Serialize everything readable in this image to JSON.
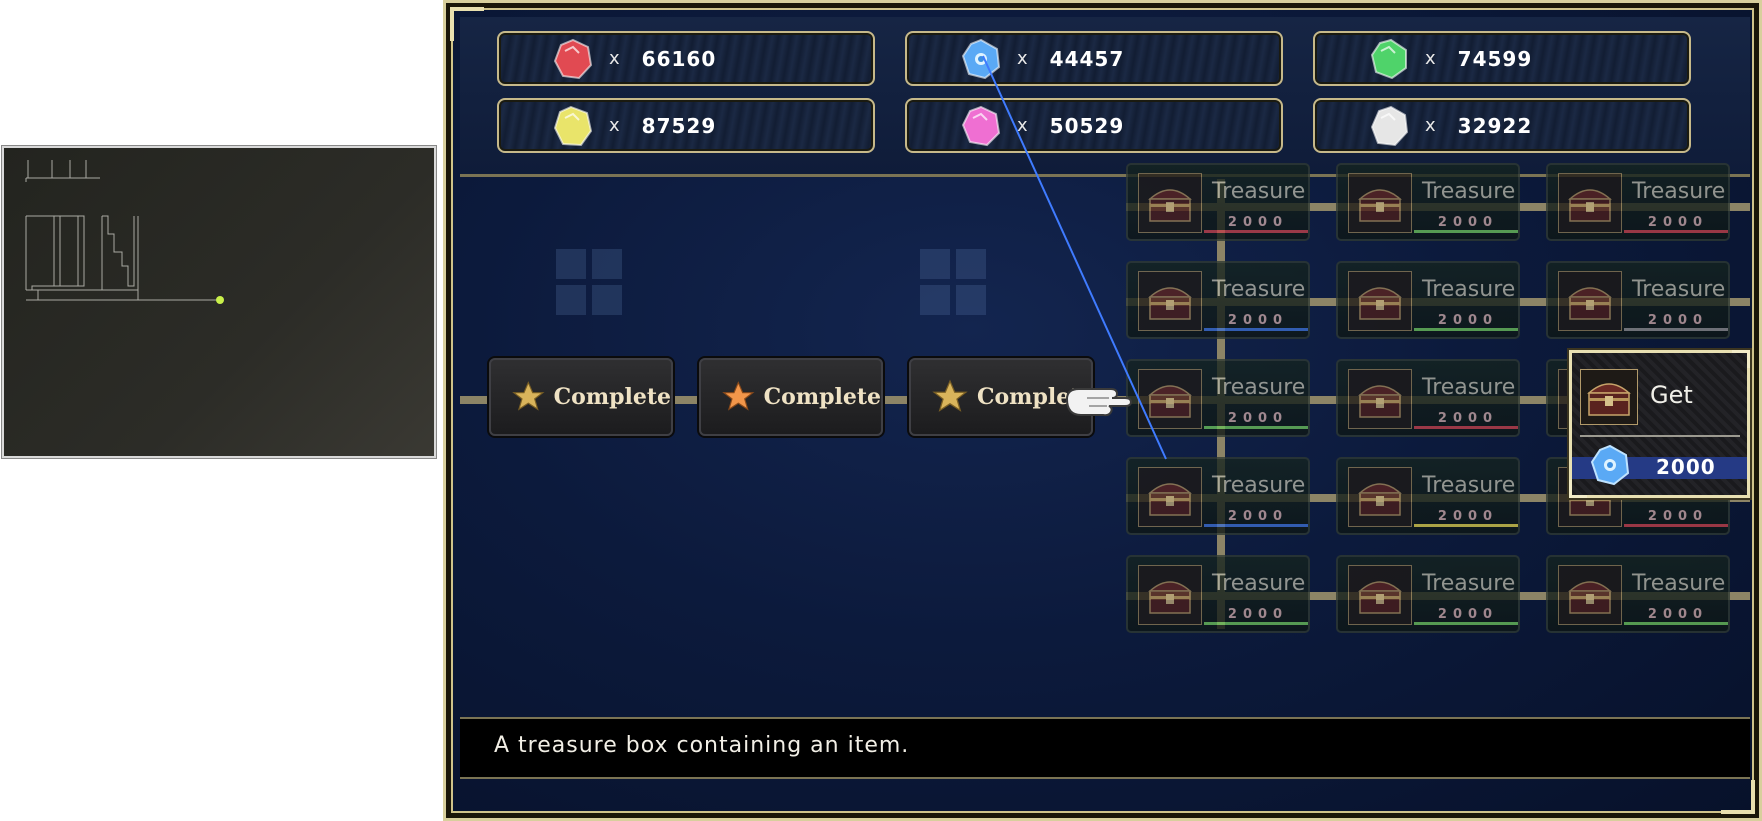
{
  "currencies": [
    {
      "color": "red",
      "hex": "#e14a52",
      "count": "66160",
      "multiplier": "x"
    },
    {
      "color": "blue",
      "hex": "#5aa9f5",
      "count": "44457",
      "multiplier": "x"
    },
    {
      "color": "green",
      "hex": "#4fd36a",
      "count": "74599",
      "multiplier": "x"
    },
    {
      "color": "yellow",
      "hex": "#e9e46a",
      "count": "87529",
      "multiplier": "x"
    },
    {
      "color": "pink",
      "hex": "#ef6fd2",
      "count": "50529",
      "multiplier": "x"
    },
    {
      "color": "white",
      "hex": "#e6e6e6",
      "count": "32922",
      "multiplier": "x"
    }
  ],
  "tree": {
    "completed": [
      {
        "label": "Complete",
        "star": "#d9b45b"
      },
      {
        "label": "Complete",
        "star": "#f2964a"
      },
      {
        "label": "Complet",
        "star": "#d9b45b"
      }
    ],
    "treasure_label": "Treasure",
    "treasure_cost": "2000",
    "selected": {
      "label": "Get",
      "cost": "2000",
      "gem": "blue"
    }
  },
  "description": "A treasure box containing an item.",
  "colors": {
    "frame_gold": "#d8cf9c",
    "background": "#0c1a3c",
    "cost_bar": "#253a85",
    "pointer_line": "#3f7bff",
    "minimap_marker": "#c9f04a"
  }
}
